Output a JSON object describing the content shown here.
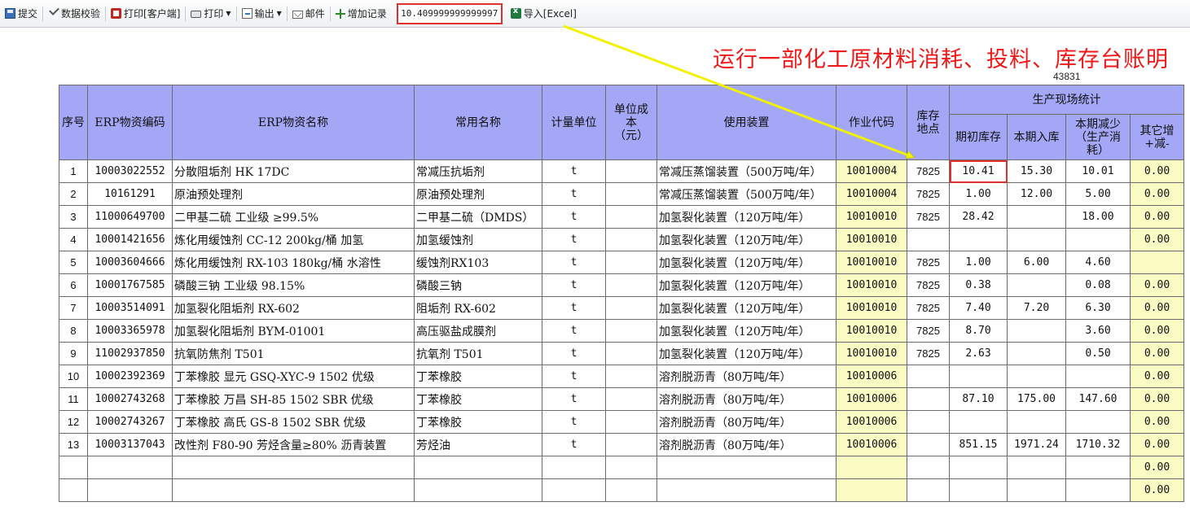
{
  "toolbar": {
    "submit": "提交",
    "validate": "数据校验",
    "print_client": "打印[客户端]",
    "print": "打印",
    "export": "输出",
    "mail": "邮件",
    "add_record": "增加记录",
    "value": "10.409999999999997",
    "import_excel": "导入[Excel]"
  },
  "report": {
    "title": "运行一部化工原材料消耗、投料、库存台账明",
    "subnum": "43831"
  },
  "headers": {
    "seq": "序号",
    "erp_code": "ERP物资编码",
    "erp_name": "ERP物资名称",
    "common_name": "常用名称",
    "unit": "计量单位",
    "unit_cost": "单位成本（元）",
    "device": "使用装置",
    "op_code": "作业代码",
    "location": "库存地点",
    "group": "生产现场统计",
    "opening": "期初库存",
    "inflow": "本期入库",
    "reduction": "本期减少（生产消耗）",
    "other": "其它增+减-"
  },
  "rows": [
    {
      "seq": "1",
      "code": "10003022552",
      "name": "分散阻垢剂 HK 17DC",
      "common": "常减压抗垢剂",
      "unit": "t",
      "cost": "",
      "device": "常减压蒸馏装置（500万吨/年）",
      "op": "10010004",
      "loc": "7825",
      "opening": "10.41",
      "inflow": "15.30",
      "reduction": "10.01",
      "other": "0.00"
    },
    {
      "seq": "2",
      "code": "10161291",
      "name": "原油预处理剂",
      "common": "原油预处理剂",
      "unit": "t",
      "cost": "",
      "device": "常减压蒸馏装置（500万吨/年）",
      "op": "10010004",
      "loc": "7825",
      "opening": "1.00",
      "inflow": "12.00",
      "reduction": "5.00",
      "other": "0.00"
    },
    {
      "seq": "3",
      "code": "11000649700",
      "name": "二甲基二硫 工业级 ≥99.5%",
      "common": "二甲基二硫（DMDS）",
      "unit": "t",
      "cost": "",
      "device": "加氢裂化装置（120万吨/年）",
      "op": "10010010",
      "loc": "7825",
      "opening": "28.42",
      "inflow": "",
      "reduction": "18.00",
      "other": "0.00"
    },
    {
      "seq": "4",
      "code": "10001421656",
      "name": "炼化用缓蚀剂 CC-12 200kg/桶 加氢",
      "common": "加氢缓蚀剂",
      "unit": "t",
      "cost": "",
      "device": "加氢裂化装置（120万吨/年）",
      "op": "10010010",
      "loc": "",
      "opening": "",
      "inflow": "",
      "reduction": "",
      "other": "0.00"
    },
    {
      "seq": "5",
      "code": "10003604666",
      "name": "炼化用缓蚀剂 RX-103 180kg/桶 水溶性",
      "common": "缓蚀剂RX103",
      "unit": "t",
      "cost": "",
      "device": "加氢裂化装置（120万吨/年）",
      "op": "10010010",
      "loc": "7825",
      "opening": "1.00",
      "inflow": "6.00",
      "reduction": "4.60",
      "other": ""
    },
    {
      "seq": "6",
      "code": "10001767585",
      "name": "磷酸三钠 工业级 98.15%",
      "common": "磷酸三钠",
      "unit": "t",
      "cost": "",
      "device": "加氢裂化装置（120万吨/年）",
      "op": "10010010",
      "loc": "7825",
      "opening": "0.38",
      "inflow": "",
      "reduction": "0.08",
      "other": "0.00"
    },
    {
      "seq": "7",
      "code": "10003514091",
      "name": "加氢裂化阻垢剂 RX-602",
      "common": "阻垢剂 RX-602",
      "unit": "t",
      "cost": "",
      "device": "加氢裂化装置（120万吨/年）",
      "op": "10010010",
      "loc": "7825",
      "opening": "7.40",
      "inflow": "7.20",
      "reduction": "6.30",
      "other": "0.00"
    },
    {
      "seq": "8",
      "code": "10003365978",
      "name": "加氢裂化阻垢剂 BYM-01001",
      "common": "高压驱盐成膜剂",
      "unit": "t",
      "cost": "",
      "device": "加氢裂化装置（120万吨/年）",
      "op": "10010010",
      "loc": "7825",
      "opening": "8.70",
      "inflow": "",
      "reduction": "3.60",
      "other": "0.00"
    },
    {
      "seq": "9",
      "code": "11002937850",
      "name": "抗氧防焦剂 T501",
      "common": "抗氧剂 T501",
      "unit": "t",
      "cost": "",
      "device": "加氢裂化装置（120万吨/年）",
      "op": "10010010",
      "loc": "7825",
      "opening": "2.63",
      "inflow": "",
      "reduction": "0.50",
      "other": "0.00"
    },
    {
      "seq": "10",
      "code": "10002392369",
      "name": "丁苯橡胶 显元 GSQ-XYC-9 1502 优级",
      "common": "丁苯橡胶",
      "unit": "t",
      "cost": "",
      "device": "溶剂脱沥青（80万吨/年）",
      "op": "10010006",
      "loc": "",
      "opening": "",
      "inflow": "",
      "reduction": "",
      "other": "0.00"
    },
    {
      "seq": "11",
      "code": "10002743268",
      "name": "丁苯橡胶 万昌 SH-85 1502 SBR 优级",
      "common": "丁苯橡胶",
      "unit": "t",
      "cost": "",
      "device": "溶剂脱沥青（80万吨/年）",
      "op": "10010006",
      "loc": "",
      "opening": "87.10",
      "inflow": "175.00",
      "reduction": "147.60",
      "other": "0.00"
    },
    {
      "seq": "12",
      "code": "10002743267",
      "name": "丁苯橡胶 高氏 GS-8 1502 SBR 优级",
      "common": "丁苯橡胶",
      "unit": "t",
      "cost": "",
      "device": "溶剂脱沥青（80万吨/年）",
      "op": "10010006",
      "loc": "",
      "opening": "",
      "inflow": "",
      "reduction": "",
      "other": "0.00"
    },
    {
      "seq": "13",
      "code": "10003137043",
      "name": "改性剂 F80-90 芳烃含量≥80% 沥青装置",
      "common": "芳烃油",
      "unit": "t",
      "cost": "",
      "device": "溶剂脱沥青（80万吨/年）",
      "op": "10010006",
      "loc": "",
      "opening": "851.15",
      "inflow": "1971.24",
      "reduction": "1710.32",
      "other": "0.00"
    },
    {
      "seq": "",
      "code": "",
      "name": "",
      "common": "",
      "unit": "",
      "cost": "",
      "device": "",
      "op": "",
      "loc": "",
      "opening": "",
      "inflow": "",
      "reduction": "",
      "other": "0.00"
    },
    {
      "seq": "",
      "code": "",
      "name": "",
      "common": "",
      "unit": "",
      "cost": "",
      "device": "",
      "op": "",
      "loc": "",
      "opening": "",
      "inflow": "",
      "reduction": "",
      "other": "0.00"
    }
  ],
  "colors": {
    "header_bg": "#a3a7f6",
    "code_bg": "#fbfbc4",
    "highlight": "#e0302e",
    "arrow": "#f2f200",
    "title": "#f01818"
  }
}
